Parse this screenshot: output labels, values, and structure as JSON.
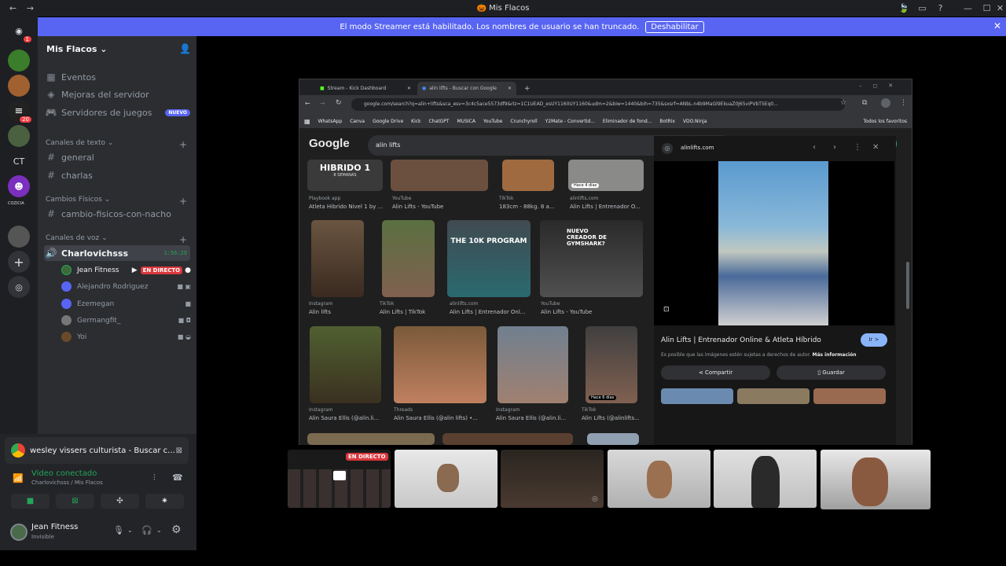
{
  "window": {
    "title": "Mis Flacos"
  },
  "banner": {
    "text": "El modo Streamer está habilitado. Los nombres de usuario se han truncado.",
    "button": "Deshabilitar"
  },
  "rail": {
    "badge_top": "1",
    "badge_mid": "20",
    "ct_label": "CT",
    "cozicia_label": "COZICIA"
  },
  "server": {
    "name": "Mis Flacos",
    "items": [
      {
        "label": "Eventos"
      },
      {
        "label": "Mejoras del servidor"
      },
      {
        "label": "Servidores de juegos",
        "badge": "NUEVO"
      }
    ],
    "categories": {
      "texto": {
        "label": "Canales de texto",
        "channels": [
          "general",
          "charlas"
        ]
      },
      "fisicos": {
        "label": "Cambios Físicos",
        "channels": [
          "cambio-fisicos-con-nacho"
        ]
      },
      "voz": {
        "label": "Canales de voz"
      }
    },
    "voice_channel": {
      "name": "Charlovichsss",
      "time": "1:56:29"
    },
    "voice_users": [
      {
        "name": "Jean Fitness",
        "live": "EN DIRECTO"
      },
      {
        "name": "Alejandro Rodriguez"
      },
      {
        "name": "Ezemegan"
      },
      {
        "name": "Germangfit_"
      },
      {
        "name": "Yoi"
      }
    ]
  },
  "panel": {
    "activity": "wesley vissers culturista - Buscar c...",
    "status": "Video conectado",
    "location": "Charlovichsss / Mis Flacos",
    "user_name": "Jean Fitness",
    "user_status": "Invisible"
  },
  "browser": {
    "tabs": [
      "Stream - Kick Dashboard",
      "alin lifts - Buscar con Google"
    ],
    "url": "google.com/search?q=alin+lifts&sca_esv=3c4c5ace5573df9&rlz=1C1UEAD_esUY1160UY1160&udm=2&biw=1440&bih=735&sxsrf=ANbL-n4b9MaGl9EkuaZ0J65viPVbT5Eq0...",
    "bookmarks": [
      "WhatsApp",
      "Canva",
      "Google Drive",
      "Kick",
      "ChatGPT",
      "MUSICA",
      "YouTube",
      "Crunchyroll",
      "Y2Mate - Convertid...",
      "Eliminador de fond...",
      "BotRix",
      "VDO.Ninja",
      "Todos los favoritos"
    ],
    "google_logo": "Google",
    "query": "alin lifts",
    "row1": [
      {
        "src": "Playbook app",
        "title": "Atleta Hibrido Nivel 1 by ...",
        "overlay": "HIBRIDO 1",
        "overlay2": "8 SEMANAS"
      },
      {
        "src": "YouTube",
        "title": "Alin Lifts - YouTube"
      },
      {
        "src": "TikTok",
        "title": "183cm - 88kg. 8 a..."
      },
      {
        "src": "alinlifts.com",
        "title": "Alin Lifts | Entrenador O...",
        "overlay": "Hace 4 días"
      }
    ],
    "row2": [
      {
        "src": "Instagram",
        "title": "Alin lifts"
      },
      {
        "src": "TikTok",
        "title": "Alin Lifts | TikTok"
      },
      {
        "src": "alinlifts.com",
        "title": "Alin Lifts | Entrenador Onl...",
        "overlay": "THE 10K PROGRAM"
      },
      {
        "src": "YouTube",
        "title": "Alin Lifts - YouTube",
        "overlay": "NUEVO CREADOR DE GYMSHARK?"
      }
    ],
    "row3": [
      {
        "src": "Instagram",
        "title": "Alin Saura Ellis (@alin.li..."
      },
      {
        "src": "Threads",
        "title": "Alin Saura Ellis (@alin lifts) •..."
      },
      {
        "src": "Instagram",
        "title": "Alin Saura Ellis (@alin.li..."
      },
      {
        "src": "TikTok",
        "title": "Alin Lifts (@alinlifts...",
        "overlay": "Hace 6 días"
      }
    ],
    "preview": {
      "domain": "alinlifts.com",
      "title": "Alin Lifts | Entrenador Online & Atleta Híbrido",
      "go": "Ir >",
      "notice": "Es posible que las imágenes estén sujetas a derechos de autor.",
      "more": "Más información",
      "share": "Compartir",
      "save": "Guardar"
    }
  },
  "stream_tiles": {
    "live": "EN DIRECTO"
  }
}
